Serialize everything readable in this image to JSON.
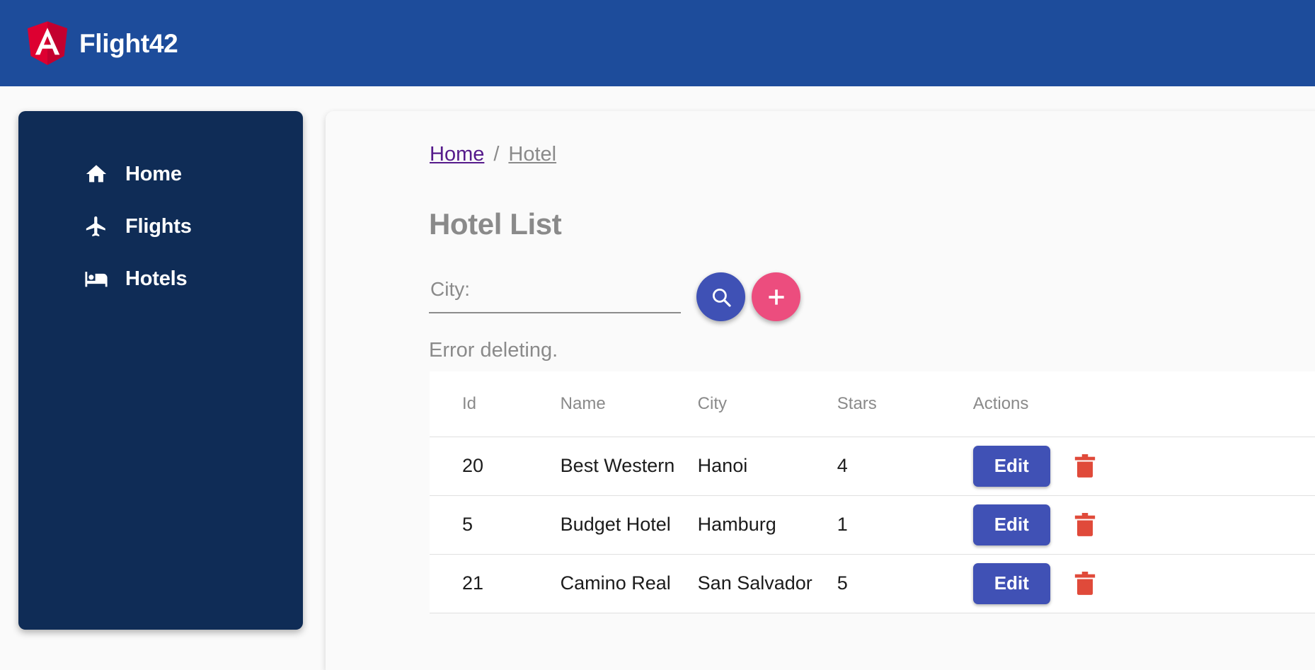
{
  "app": {
    "brand_title": "Flight42",
    "logo_icon": "angular-logo-icon",
    "topbar_color": "#1d4c9b",
    "sidebar_color": "#0f2c56"
  },
  "sidebar": {
    "items": [
      {
        "label": "Home",
        "icon": "home-icon"
      },
      {
        "label": "Flights",
        "icon": "airplane-icon"
      },
      {
        "label": "Hotels",
        "icon": "bed-icon"
      }
    ]
  },
  "breadcrumb": {
    "home": "Home",
    "separator": "/",
    "current": "Hotel",
    "home_color": "#551a8b",
    "current_color": "#8a8a8a"
  },
  "main": {
    "page_title": "Hotel List",
    "error_message": "Error deleting.",
    "search": {
      "label": "City:",
      "value": "",
      "placeholder": "City:",
      "search_button_icon": "search-icon",
      "search_button_color": "#3f51b5",
      "add_button_icon": "plus-icon",
      "add_button_color": "#ec4d7e"
    },
    "table": {
      "columns": [
        "Id",
        "Name",
        "City",
        "Stars",
        "Actions"
      ],
      "rows": [
        {
          "id": "20",
          "name": "Best Western",
          "city": "Hanoi",
          "stars": "4",
          "edit_label": "Edit",
          "delete_icon": "trash-icon"
        },
        {
          "id": "5",
          "name": "Budget Hotel",
          "city": "Hamburg",
          "stars": "1",
          "edit_label": "Edit",
          "delete_icon": "trash-icon"
        },
        {
          "id": "21",
          "name": "Camino Real",
          "city": "San Salvador",
          "stars": "5",
          "edit_label": "Edit",
          "delete_icon": "trash-icon"
        }
      ],
      "edit_button_color": "#4051b5",
      "delete_icon_color": "#e04a3a"
    }
  }
}
